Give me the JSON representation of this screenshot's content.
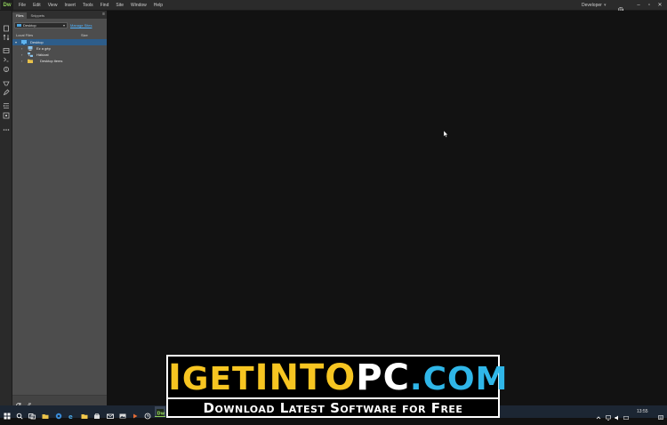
{
  "app": {
    "logo": "Dw",
    "menu": [
      "File",
      "Edit",
      "View",
      "Insert",
      "Tools",
      "Find",
      "Site",
      "Window",
      "Help"
    ],
    "workspace": "Developer",
    "window_controls": [
      "–",
      "▫",
      "✕"
    ]
  },
  "panel": {
    "tabs": [
      "Files",
      "Snippets"
    ],
    "site_select": "Desktop",
    "manage_sites": "Manage Sites",
    "col_local": "Local Files",
    "col_size": "Size",
    "tree": [
      {
        "label": "Desktop",
        "selected": true,
        "icon": "desktop-icon"
      },
      {
        "label": "Ez a gép",
        "selected": false,
        "icon": "computer-icon"
      },
      {
        "label": "Hálózat",
        "selected": false,
        "icon": "network-icon"
      },
      {
        "label": "Desktop items",
        "selected": false,
        "icon": "folder-icon"
      }
    ]
  },
  "taskbar": {
    "clock": "13:55"
  },
  "banner": {
    "brand_i": "I",
    "brand_get": "GET",
    "brand_into": "INTO",
    "brand_pc": "PC",
    "brand_dot": ".",
    "brand_com": "COM",
    "tagline": "Download Latest Software for Free"
  },
  "colors": {
    "accent": "#8fcf5c",
    "selection": "#2d5d8a",
    "link": "#4fb3ff",
    "brand_yellow": "#f7c521",
    "brand_blue": "#2fb6e8"
  }
}
